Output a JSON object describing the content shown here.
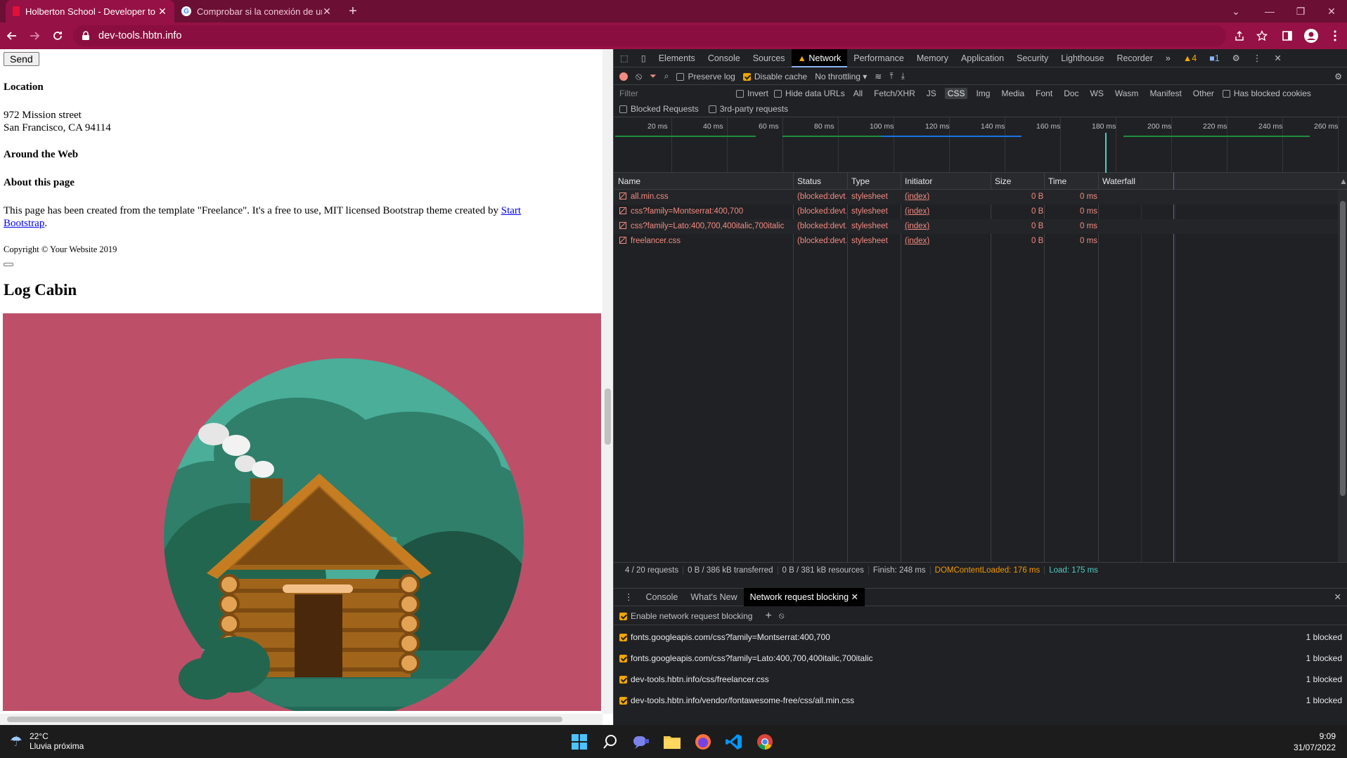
{
  "browser": {
    "tabs": [
      {
        "title": "Holberton School - Developer to",
        "active": true
      },
      {
        "title": "Comprobar si la conexión de un",
        "active": false
      }
    ],
    "url": "dev-tools.hbtn.info"
  },
  "page": {
    "send_button": "Send",
    "location_heading": "Location",
    "address_line1": "972 Mission street",
    "address_line2": "San Francisco, CA 94114",
    "around_heading": "Around the Web",
    "about_heading": "About this page",
    "about_text": "This page has been created from the template \"Freelance\". It's a free to use, MIT licensed Bootstrap theme created by",
    "about_link": "Start Bootstrap",
    "about_end": ".",
    "copyright": "Copyright © Your Website 2019",
    "section_title": "Log Cabin"
  },
  "devtools": {
    "tabs": [
      "Elements",
      "Console",
      "Sources",
      "Network",
      "Performance",
      "Memory",
      "Application",
      "Security",
      "Lighthouse",
      "Recorder"
    ],
    "active_tab": "Network",
    "warning_count": "4",
    "message_count": "1",
    "toolbar": {
      "preserve_log": "Preserve log",
      "disable_cache": "Disable cache",
      "throttling": "No throttling"
    },
    "filter": {
      "placeholder": "Filter",
      "invert": "Invert",
      "hide_data_urls": "Hide data URLs",
      "types": [
        "All",
        "Fetch/XHR",
        "JS",
        "CSS",
        "Img",
        "Media",
        "Font",
        "Doc",
        "WS",
        "Wasm",
        "Manifest",
        "Other"
      ],
      "selected_type": "CSS",
      "has_blocked_cookies": "Has blocked cookies",
      "blocked_requests": "Blocked Requests",
      "third_party": "3rd-party requests"
    },
    "overview_ticks": [
      "20 ms",
      "40 ms",
      "60 ms",
      "80 ms",
      "100 ms",
      "120 ms",
      "140 ms",
      "160 ms",
      "180 ms",
      "200 ms",
      "220 ms",
      "240 ms",
      "260 ms"
    ],
    "columns": [
      "Name",
      "Status",
      "Type",
      "Initiator",
      "Size",
      "Time",
      "Waterfall"
    ],
    "requests": [
      {
        "name": "all.min.css",
        "status": "(blocked:devt...",
        "type": "stylesheet",
        "initiator": "(index)",
        "size": "0 B",
        "time": "0 ms"
      },
      {
        "name": "css?family=Montserrat:400,700",
        "status": "(blocked:devt...",
        "type": "stylesheet",
        "initiator": "(index)",
        "size": "0 B",
        "time": "0 ms"
      },
      {
        "name": "css?family=Lato:400,700,400italic,700italic",
        "status": "(blocked:devt...",
        "type": "stylesheet",
        "initiator": "(index)",
        "size": "0 B",
        "time": "0 ms"
      },
      {
        "name": "freelancer.css",
        "status": "(blocked:devt...",
        "type": "stylesheet",
        "initiator": "(index)",
        "size": "0 B",
        "time": "0 ms"
      }
    ],
    "summary": {
      "requests": "4 / 20 requests",
      "transferred": "0 B / 386 kB transferred",
      "resources": "0 B / 381 kB resources",
      "finish": "Finish: 248 ms",
      "dcl": "DOMContentLoaded: 176 ms",
      "load": "Load: 175 ms"
    },
    "drawer": {
      "tabs": [
        "Console",
        "What's New",
        "Network request blocking"
      ],
      "active_tab": "Network request blocking",
      "enable_label": "Enable network request blocking",
      "patterns": [
        {
          "url": "fonts.googleapis.com/css?family=Montserrat:400,700",
          "count": "1 blocked"
        },
        {
          "url": "fonts.googleapis.com/css?family=Lato:400,700,400italic,700italic",
          "count": "1 blocked"
        },
        {
          "url": "dev-tools.hbtn.info/css/freelancer.css",
          "count": "1 blocked"
        },
        {
          "url": "dev-tools.hbtn.info/vendor/fontawesome-free/css/all.min.css",
          "count": "1 blocked"
        }
      ]
    }
  },
  "taskbar": {
    "temperature": "22°C",
    "weather_text": "Lluvia próxima",
    "time": "9:09",
    "date": "31/07/2022"
  },
  "colors": {
    "chrome_frame": "#6b0f35",
    "chrome_toolbar": "#961145",
    "page_scene": "#bd5068",
    "devtools_bg": "#202124",
    "blocked_red": "#f28b82",
    "dcl_orange": "#f29900",
    "load_teal": "#4ecdc4"
  }
}
